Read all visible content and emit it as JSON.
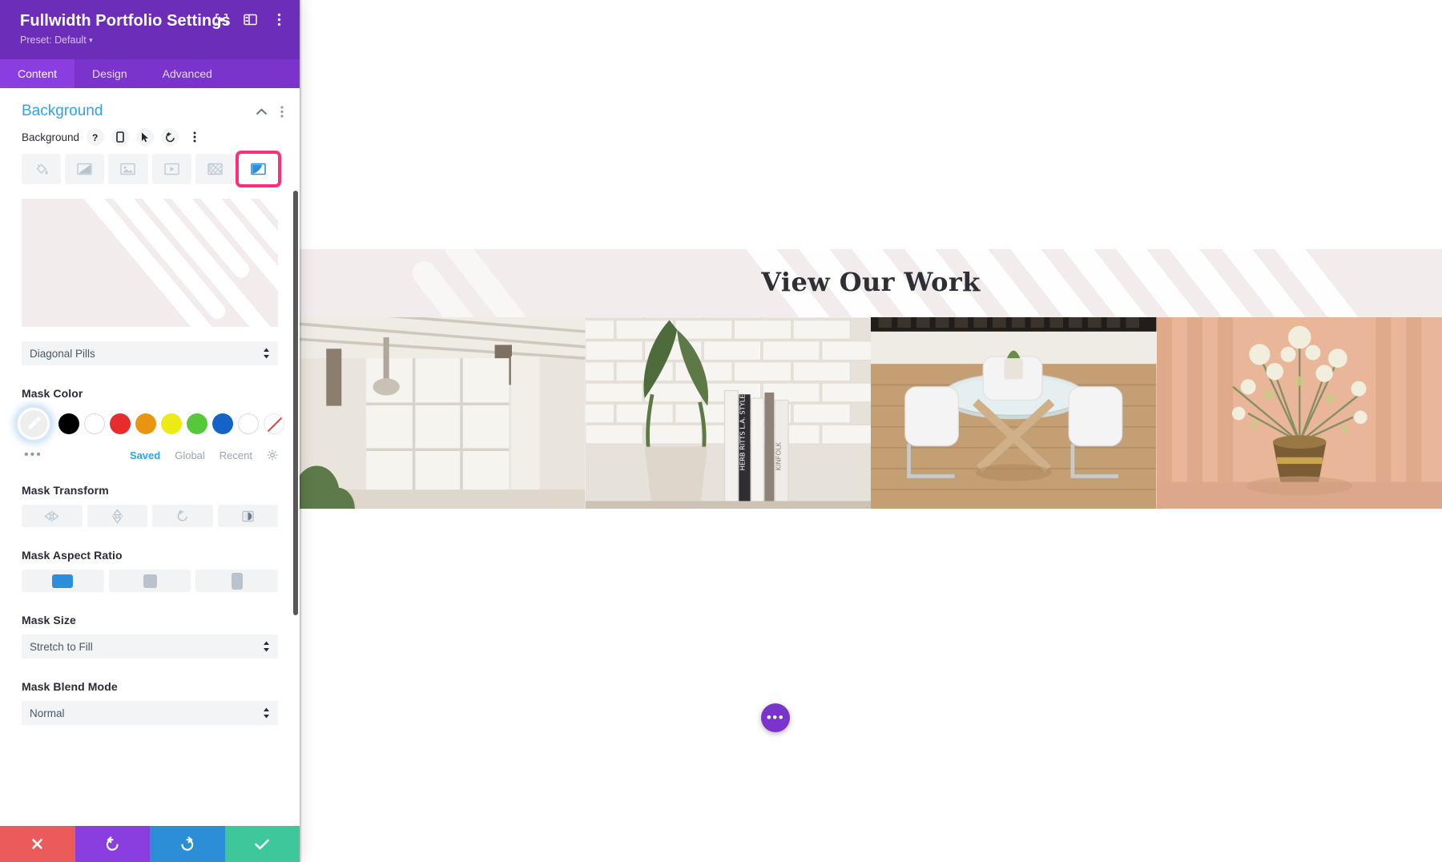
{
  "panel": {
    "title": "Fullwidth Portfolio Settings",
    "preset_label": "Preset: Default",
    "preset_caret": "▾",
    "header_icons": [
      {
        "name": "expand-icon"
      },
      {
        "name": "layout-toggle-icon"
      },
      {
        "name": "kebab-menu-icon"
      }
    ],
    "tabs": [
      {
        "label": "Content",
        "active": true
      },
      {
        "label": "Design",
        "active": false
      },
      {
        "label": "Advanced",
        "active": false
      }
    ],
    "section": {
      "title": "Background",
      "collapse_icon": "chevron-up-icon",
      "kebab_icon": "kebab-menu-icon"
    },
    "background_field": {
      "label": "Background",
      "controls": [
        "help-icon",
        "responsive-icon",
        "hover-icon",
        "reset-icon",
        "kebab-menu-icon"
      ],
      "types": [
        {
          "name": "background-color",
          "selected": false
        },
        {
          "name": "background-gradient",
          "selected": false
        },
        {
          "name": "background-image",
          "selected": false
        },
        {
          "name": "background-video",
          "selected": false
        },
        {
          "name": "background-pattern",
          "selected": false
        },
        {
          "name": "background-mask",
          "selected": true
        }
      ],
      "selected_outline_color": "#ff2d7a"
    },
    "mask_style": {
      "label": "",
      "value": "Diagonal Pills"
    },
    "mask_color": {
      "label": "Mask Color",
      "eyedropper_active": true,
      "swatches": [
        {
          "name": "swatch-black",
          "color": "#000000"
        },
        {
          "name": "swatch-white",
          "color": "#ffffff"
        },
        {
          "name": "swatch-red",
          "color": "#e62c2c"
        },
        {
          "name": "swatch-orange",
          "color": "#e89611"
        },
        {
          "name": "swatch-yellow",
          "color": "#edeb16"
        },
        {
          "name": "swatch-green",
          "color": "#56c83c"
        },
        {
          "name": "swatch-blue",
          "color": "#1464c8"
        },
        {
          "name": "swatch-empty",
          "color": "#ffffff"
        }
      ],
      "no_color": {
        "name": "swatch-no-color"
      },
      "more_dots": "•••",
      "tabs": [
        {
          "label": "Saved",
          "active": true
        },
        {
          "label": "Global",
          "active": false
        },
        {
          "label": "Recent",
          "active": false
        }
      ],
      "gear_icon": "gear-icon"
    },
    "mask_transform": {
      "label": "Mask Transform",
      "buttons": [
        {
          "name": "flip-horizontal-icon"
        },
        {
          "name": "flip-vertical-icon"
        },
        {
          "name": "rotate-icon"
        },
        {
          "name": "invert-icon"
        }
      ]
    },
    "mask_aspect_ratio": {
      "label": "Mask Aspect Ratio",
      "options": [
        {
          "name": "aspect-landscape",
          "active": true
        },
        {
          "name": "aspect-square",
          "active": false
        },
        {
          "name": "aspect-portrait",
          "active": false
        }
      ],
      "active_color": "#2d8fd9"
    },
    "mask_size": {
      "label": "Mask Size",
      "value": "Stretch to Fill"
    },
    "mask_blend_mode": {
      "label": "Mask Blend Mode",
      "value": "Normal"
    },
    "actions": [
      {
        "name": "cancel-button",
        "icon": "close-icon",
        "color": "#eb5b5b"
      },
      {
        "name": "undo-button",
        "icon": "undo-icon",
        "color": "#8a3ee0"
      },
      {
        "name": "redo-button",
        "icon": "redo-icon",
        "color": "#2b8ed6"
      },
      {
        "name": "save-button",
        "icon": "checkmark-icon",
        "color": "#3dc79a"
      }
    ]
  },
  "preview": {
    "hero_title": "View Our Work",
    "hero_bg_color": "#f2eced",
    "gallery": [
      {
        "name": "portfolio-image-loft-window"
      },
      {
        "name": "portfolio-image-books-plant"
      },
      {
        "name": "portfolio-image-dining-set"
      },
      {
        "name": "portfolio-image-flower-vase"
      }
    ],
    "fab": {
      "name": "page-settings-fab",
      "label": "•••",
      "color": "#7a34cc"
    }
  }
}
